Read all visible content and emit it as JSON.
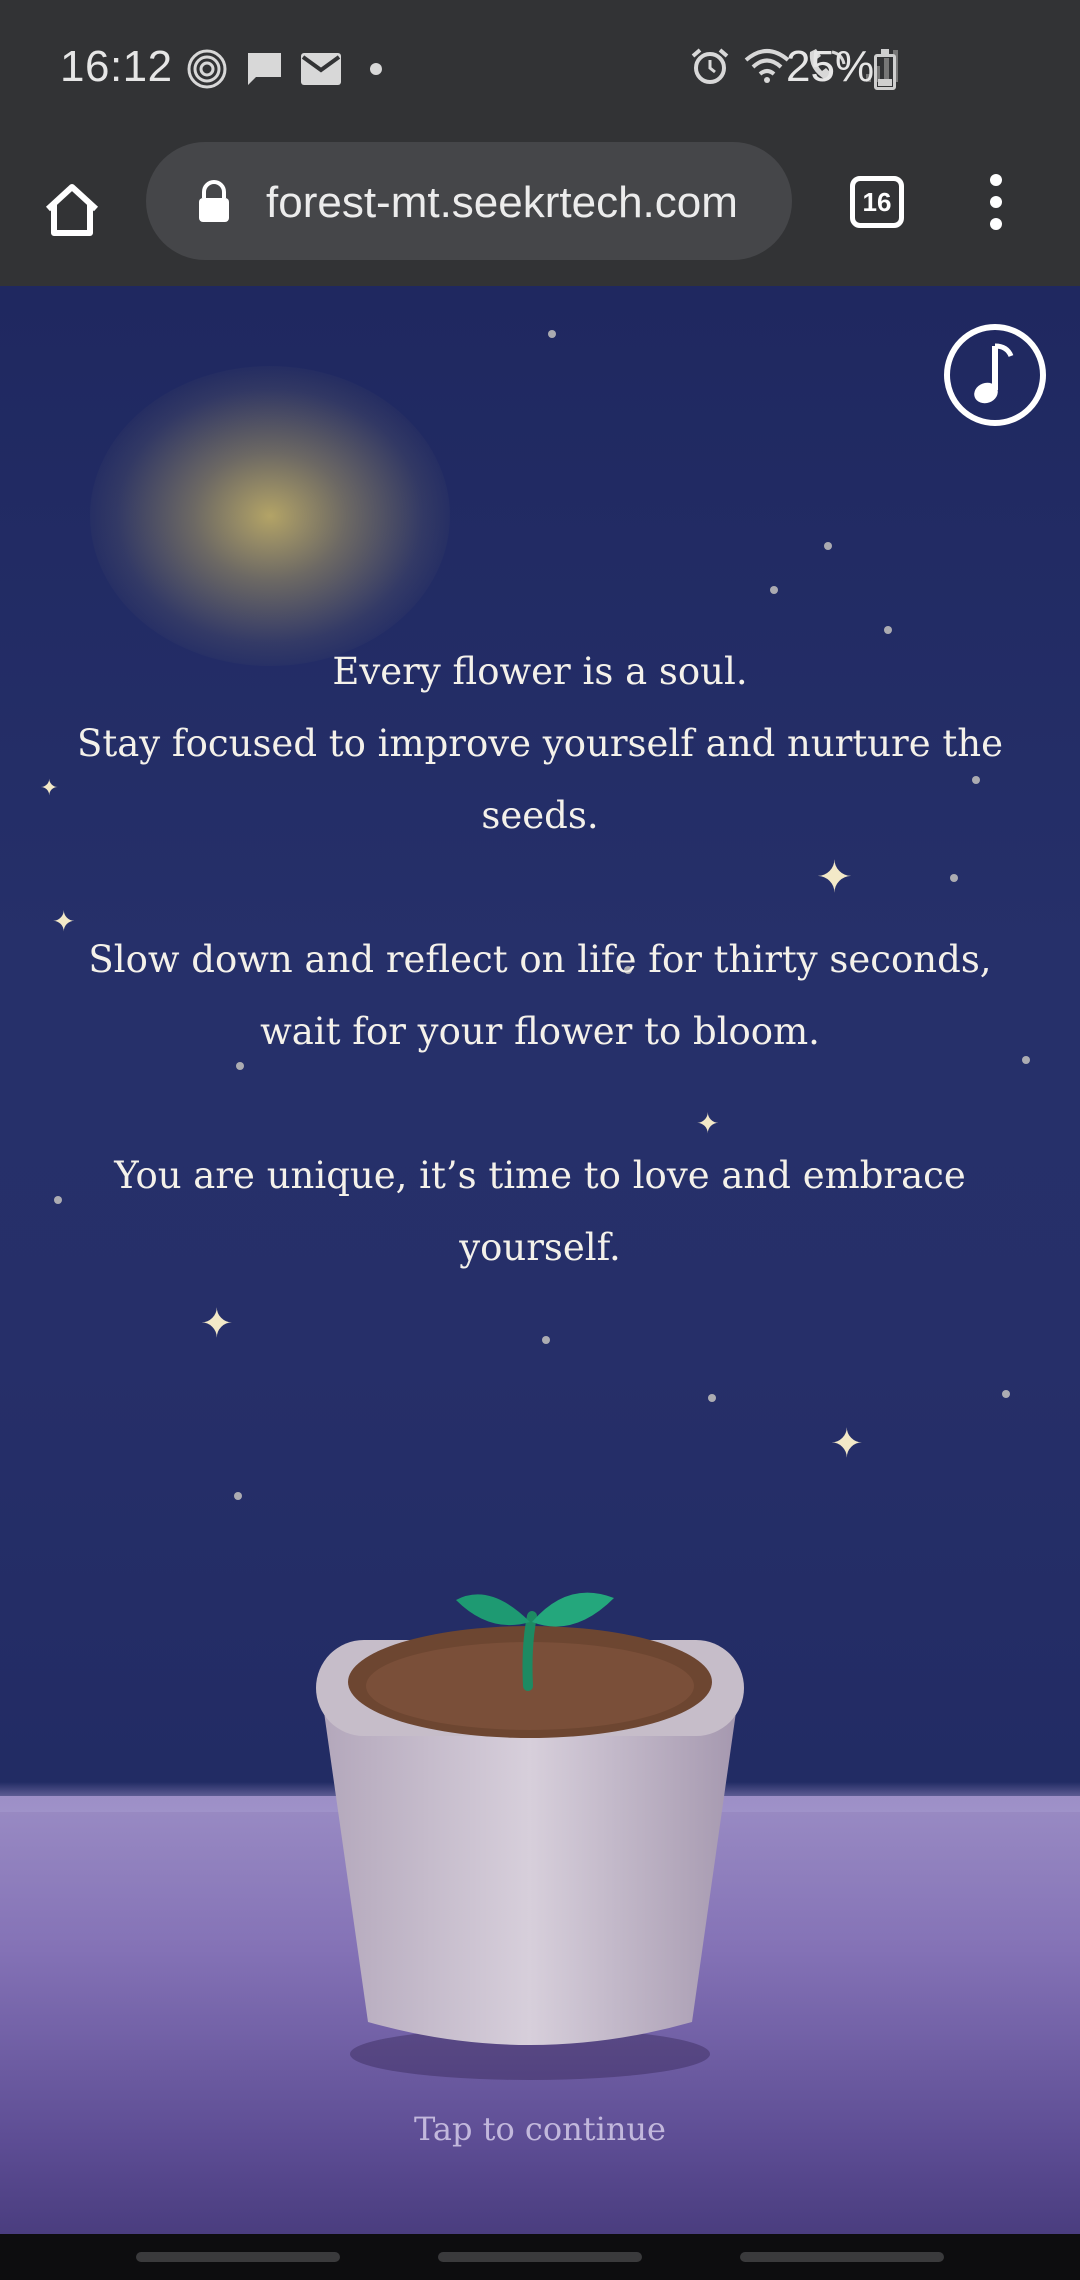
{
  "status_bar": {
    "time": "16:12",
    "battery_text": "25%",
    "battery_level": 0.25,
    "left_icons": [
      "fingerprint-icon",
      "chat-icon",
      "mail-icon",
      "dot-icon"
    ],
    "right_icons": [
      "alarm-icon",
      "wifi-icon",
      "wifi-call-icon",
      "signal-icon",
      "battery-icon"
    ]
  },
  "browser": {
    "url": "forest-mt.seekrtech.com",
    "tab_count": "16"
  },
  "content": {
    "message_lines": [
      "Every flower is a soul.\nStay focused to improve yourself and nurture the seeds.",
      "Slow down and reflect on life for thirty seconds, wait for your flower to bloom.",
      "You are unique, it’s time to love and embrace yourself."
    ],
    "paragraph_1_line_1": "Every flower is a soul.",
    "paragraph_1_line_2": "Stay focused to improve yourself and nurture the seeds.",
    "paragraph_2": "Slow down and reflect on life for thirty seconds, wait for your flower to bloom.",
    "paragraph_3": "You are unique, it’s time to love and embrace yourself.",
    "tap_prompt": "Tap to continue"
  },
  "colors": {
    "sky": "#262f69",
    "ground": "#8472b6",
    "moon": "#f3cf46",
    "sprout": "#1f9a6e",
    "soil": "#6a4430",
    "pot": "#c9bfcf"
  }
}
